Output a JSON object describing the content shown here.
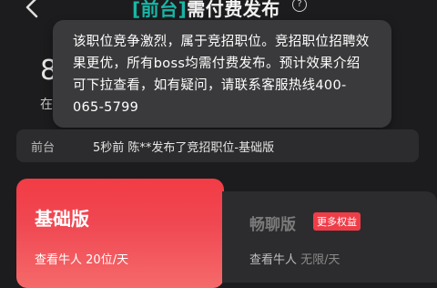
{
  "header": {
    "title_tag": "[前台]",
    "title_main": "需付费发布",
    "help_symbol": "?"
  },
  "background": {
    "digit": "8",
    "char": "在"
  },
  "tooltip": {
    "text": "该职位竞争激烈，属于竞招职位。竞招职位招聘效果更优，所有boss均需付费发布。预计效果介绍可下拉查看，如有疑问，请联系客服热线400-065-5799"
  },
  "info_bar": {
    "label": "前台",
    "message": "5秒前 陈**发布了竞招职位-基础版"
  },
  "plans": [
    {
      "name": "基础版",
      "view_label": "查看牛人",
      "view_value": "20位/天"
    },
    {
      "name": "畅聊版",
      "badge": "更多权益",
      "view_label": "查看牛人",
      "view_value": "无限/天"
    }
  ],
  "colors": {
    "accent_red": "#f23c45",
    "tag_teal": "#19b6a6",
    "background": "#1c1c1e",
    "tooltip_bg": "#3a3a3c"
  }
}
